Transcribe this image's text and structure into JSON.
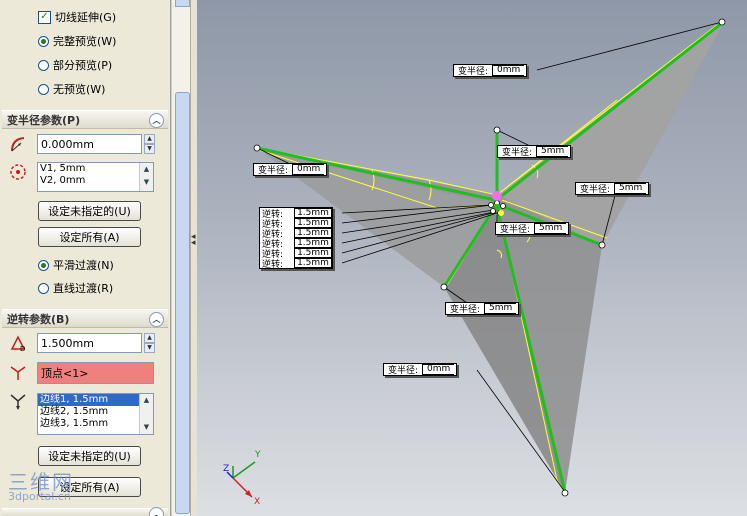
{
  "options": {
    "tangent_propagation": "切线延伸(G)",
    "full_preview": "完整预览(W)",
    "partial_preview": "部分预览(P)",
    "no_preview": "无预览(W)"
  },
  "variable_radius": {
    "header": "变半径参数(P)",
    "radius_value": "0.000mm",
    "vertices": [
      "V1, 5mm",
      "V2, 0mm"
    ],
    "set_unassigned": "设定未指定的(U)",
    "set_all": "设定所有(A)",
    "smooth": "平滑过渡(N)",
    "straight": "直线过渡(R)"
  },
  "setback": {
    "header": "逆转参数(B)",
    "distance_value": "1.500mm",
    "vertex": "顶点<1>",
    "edges": [
      "边线1, 1.5mm",
      "边线2, 1.5mm",
      "边线3, 1.5mm"
    ],
    "set_unassigned": "设定未指定的(U)",
    "set_all": "设定所有(A)"
  },
  "viewport": {
    "callouts": [
      {
        "label": "变半径:",
        "value": "0mm"
      },
      {
        "label": "变半径:",
        "value": "5mm"
      },
      {
        "label": "变半径:",
        "value": "0mm"
      },
      {
        "label": "变半径:",
        "value": "5mm"
      },
      {
        "label": "变半径:",
        "value": "5mm"
      },
      {
        "label": "变半径:",
        "value": "5mm"
      },
      {
        "label": "变半径:",
        "value": "0mm"
      }
    ],
    "setback_callouts": [
      {
        "label": "逆转:",
        "value": "1.5mm"
      },
      {
        "label": "逆转:",
        "value": "1.5mm"
      },
      {
        "label": "逆转:",
        "value": "1.5mm"
      },
      {
        "label": "逆转:",
        "value": "1.5mm"
      },
      {
        "label": "逆转:",
        "value": "1.5mm"
      },
      {
        "label": "逆转:",
        "value": "1.5mm"
      }
    ],
    "triad": {
      "x": "X",
      "y": "Y",
      "z": "Z"
    }
  },
  "watermark": {
    "main": "三维网",
    "sub": "3dportal.cn"
  },
  "colors": {
    "edge_green": "#1fbf1f",
    "edge_yellow": "#ffff33",
    "selection_red": "#f08080",
    "highlight_magenta": "#ff66ff"
  }
}
